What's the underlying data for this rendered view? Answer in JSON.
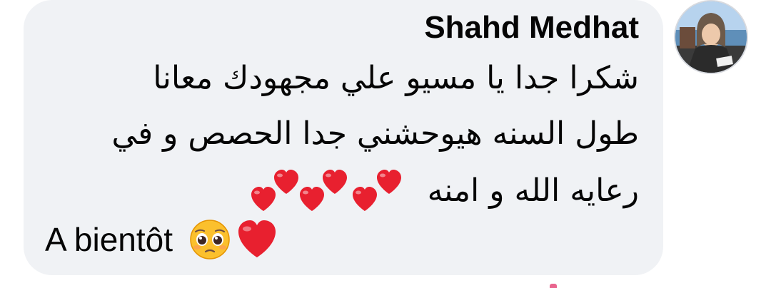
{
  "comment": {
    "author": "Shahd Medhat",
    "lines": [
      "شكرا جدا يا مسيو علي مجهودك معانا",
      "طول السنه هيوحشني جدا الحصص و في",
      "رعايه الله و امنه",
      "A bientôt"
    ],
    "emojis": {
      "line3": [
        "red-heart",
        "red-heart",
        "red-heart",
        "red-heart",
        "red-heart",
        "red-heart"
      ],
      "line4": [
        "pleading-face",
        "red-heart"
      ]
    }
  },
  "colors": {
    "bubble_bg": "#f0f2f5",
    "text": "#050505",
    "heart": "#e8202f"
  }
}
